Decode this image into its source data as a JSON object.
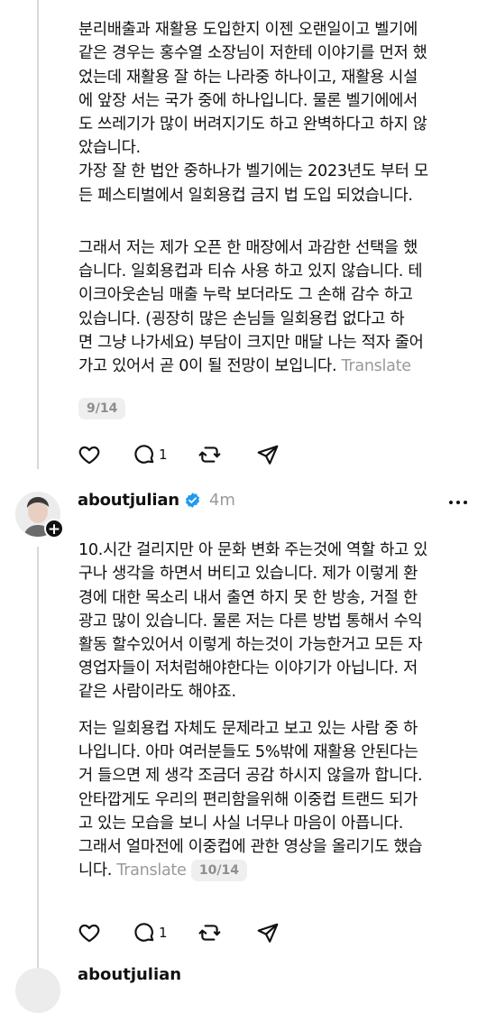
{
  "post_top": {
    "paragraph_1": "분리배출과 재활용 도입한지 이젠 오랜일이고 벨기에\n같은 경우는 홍수열 소장님이 저한테 이야기를 먼저 했\n었는데 재활용 잘 하는 나라중 하나이고, 재활용 시설\n에 앞장 서는 국가 중에 하나입니다. 물론 벨기에에서\n도 쓰레기가 많이 버려지기도 하고 완벽하다고 하지 않\n았습니다.\n가장 잘 한 법안 중하나가 벨기에는 2023년도 부터 모\n든 페스티벌에서 일회용컵 금지 법 도입 되었습니다.",
    "paragraph_2": "그래서 저는 제가 오픈 한 매장에서 과감한 선택을 했\n습니다. 일회용컵과 티슈 사용 하고 있지 않습니다. 테\n이크아웃손님 매출 누락 보더라도 그 손해 감수 하고\n있습니다. (굉장히 많은 손님들 일회용컵 없다고 하\n면 그냥 나가세요) 부담이 크지만 매달 나는 적자 줄어\n가고 있어서 곧 0이 될 전망이 보입니다.",
    "translate_label": "Translate",
    "counter": "9/14",
    "reply_count": "1"
  },
  "post_main": {
    "username": "aboutjulian",
    "time": "4m",
    "verified": true,
    "paragraph_1": "10.시간 걸리지만 아 문화 변화 주는것에 역할 하고 있\n구나 생각을 하면서 버티고 있습니다. 제가 이렇게 환\n경에 대한 목소리 내서 출연 하지 못 한 방송, 거절 한\n광고 많이 있습니다. 물론 저는 다른 방법 통해서 수익\n활동 할수있어서 이렇게 하는것이 가능한거고 모든 자\n영업자들이 저처럼해야한다는 이야기가 아닙니다. 저\n같은 사람이라도 해야죠.",
    "paragraph_2": "저는 일회용컵 자체도 문제라고 보고 있는 사람 중 하\n나입니다. 아마 여러분들도 5%밖에 재활용 안된다는\n거 들으면 제 생각 조금더 공감 하시지 않을까 합니다.\n안타깝게도 우리의 편리함을위해 이중컵 트랜드 되가\n고 있는 모습을 보니 사실 너무나 마음이 아픕니다.\n그래서 얼마전에 이중컵에 관한 영상을 올리기도 했습\n니다.",
    "translate_label": "Translate",
    "counter": "10/14",
    "reply_count": "1"
  },
  "post_next": {
    "username": "aboutjulian"
  },
  "colors": {
    "text": "#111111",
    "muted": "#9a9a9a",
    "verified_badge": "#1d9bf0",
    "thread_line": "#d9d9d9"
  }
}
